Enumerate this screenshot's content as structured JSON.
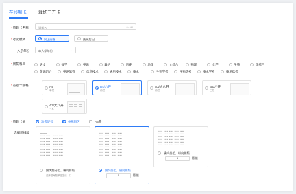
{
  "tabs": [
    {
      "label": "在线制卡"
    },
    {
      "label": "裁切三方卡"
    }
  ],
  "form": {
    "name": {
      "label": "答题卡名称",
      "placeholder": "请输入",
      "counter": "0 / 40"
    },
    "mode": {
      "label": "考试模式",
      "options": [
        "网上阅卷",
        "先阅后扫"
      ],
      "selected": 0
    },
    "grade": {
      "label": "入学年份",
      "value": "本人学年份"
    },
    "subject": {
      "label": "所属科目",
      "options": [
        "语文",
        "数学",
        "英语",
        "政治",
        "历史",
        "地理",
        "文综合",
        "物理",
        "化学",
        "生物",
        "理综合",
        "英语听力",
        "英语笔答",
        "信息技术",
        "通用技术",
        "技术",
        "生物学考",
        "生物选考",
        "技术学考",
        "技术选考"
      ]
    },
    "paper": {
      "label": "答题卡规格",
      "options": [
        {
          "name": "A4",
          "sub": "单栏"
        },
        {
          "name": "B4/八开",
          "sub": "两栏"
        },
        {
          "name": "A3/大八开",
          "sub": "两栏"
        },
        {
          "name": "B4/八开",
          "sub": "三栏"
        },
        {
          "name": "A3/大八开",
          "sub": "三栏"
        }
      ],
      "selected": 1
    },
    "header": {
      "label": "答题卡头",
      "options": [
        {
          "name": "准考证号",
          "checked": true
        },
        {
          "name": "条形码区",
          "checked": true
        },
        {
          "name": "AB卷",
          "checked": false
        }
      ]
    },
    "layout": {
      "label": "选择题排版",
      "options": [
        {
          "caption": "按大题分组，横向排版",
          "note": "选择题每题单独生成一行",
          "selected": false
        },
        {
          "caption": "按列分组，横向排版",
          "per_group": "5",
          "unit": "题/组",
          "selected": true
        },
        {
          "caption": "横向分组，纵向排版",
          "per_group": "5",
          "unit": "题/组",
          "selected": false
        }
      ]
    }
  },
  "colors": {
    "accent": "#2f7cf6",
    "required": "#e8453c"
  }
}
